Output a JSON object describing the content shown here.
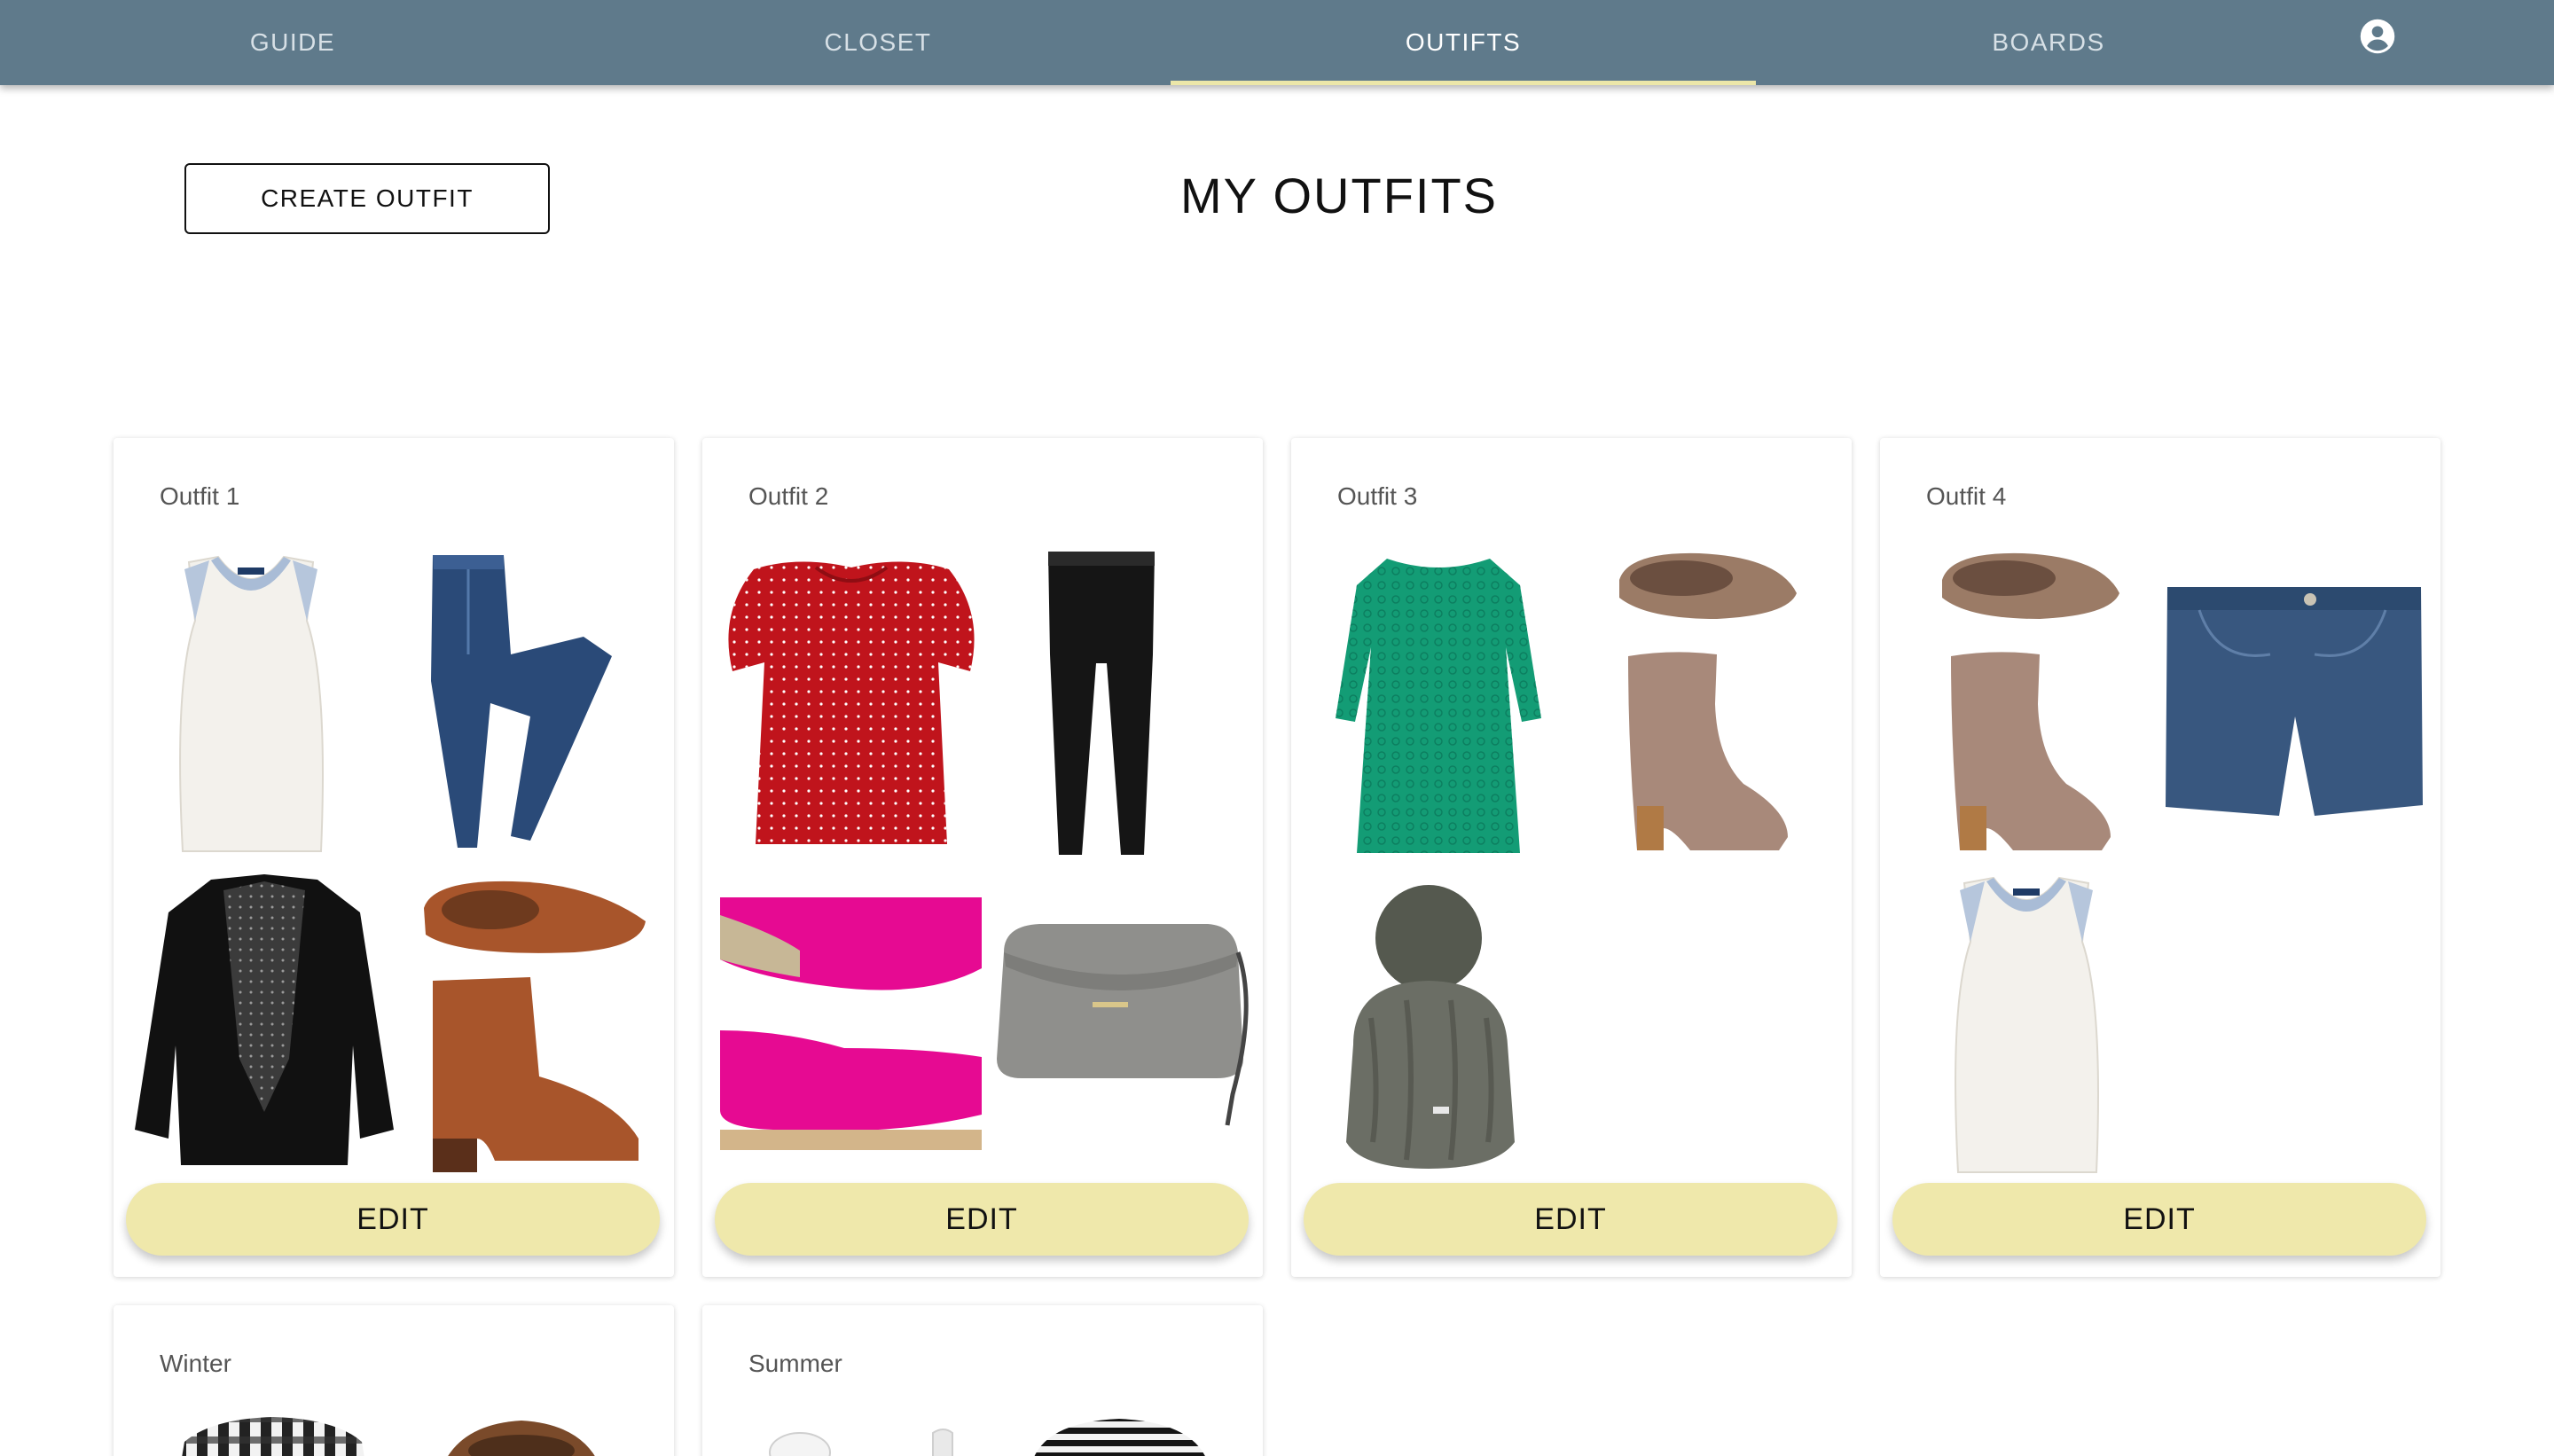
{
  "nav": {
    "tabs": [
      {
        "label": "GUIDE"
      },
      {
        "label": "CLOSET"
      },
      {
        "label": "OUTIFTS"
      },
      {
        "label": "BOARDS"
      }
    ],
    "active_tab": "OUTIFTS",
    "account_icon": "account-circle-icon",
    "colors": {
      "bar": "#5f7a8b",
      "indicator": "#ece7a9"
    }
  },
  "header": {
    "create_button_label": "CREATE OUTFIT",
    "page_title": "MY OUTFITS"
  },
  "outfits": [
    {
      "title": "Outfit 1",
      "edit_label": "EDIT",
      "items": [
        "white-tank-top",
        "blue-skinny-jeans",
        "black-velvet-blazer",
        "brown-ankle-boots"
      ]
    },
    {
      "title": "Outfit 2",
      "edit_label": "EDIT",
      "items": [
        "red-polka-dot-blouse",
        "black-skinny-jeans",
        "pink-suede-loafers",
        "gray-crossbody-bag"
      ]
    },
    {
      "title": "Outfit 3",
      "edit_label": "EDIT",
      "items": [
        "green-lace-dress",
        "taupe-slouch-boots",
        "gray-knit-pom-beanie"
      ]
    },
    {
      "title": "Outfit 4",
      "edit_label": "EDIT",
      "items": [
        "taupe-slouch-boots",
        "denim-shorts",
        "white-tank-top"
      ]
    },
    {
      "title": "Winter",
      "items": [
        "plaid-shirt",
        "brown-boots"
      ]
    },
    {
      "title": "Summer",
      "items": [
        "white-earbuds",
        "striped-top"
      ]
    }
  ],
  "colors": {
    "edit_button": "#efe8ab"
  }
}
